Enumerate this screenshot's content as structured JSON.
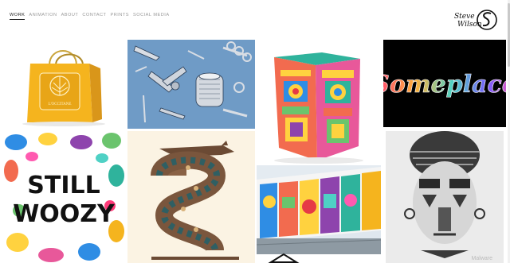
{
  "nav": {
    "items": [
      {
        "label": "WORK",
        "active": true
      },
      {
        "label": "ANIMATION"
      },
      {
        "label": "ABOUT"
      },
      {
        "label": "CONTACT"
      },
      {
        "label": "PRINTS"
      },
      {
        "label": "SOCIAL MEDIA"
      }
    ]
  },
  "logo": {
    "text_line1": "Steve",
    "text_line2": "Wilson"
  },
  "tiles": {
    "bag": {
      "brand": "L'OCCITANE"
    },
    "someplace": {
      "title": "Someplace"
    },
    "stillwoozy": {
      "line1": "STILL",
      "line2": "WOOZY"
    }
  },
  "watermark": "Malware",
  "colors": {
    "accent": "#222222",
    "nav_inactive": "#9a9a9a",
    "tools_bg": "#6f9bc6",
    "someplace_bg": "#000000"
  }
}
